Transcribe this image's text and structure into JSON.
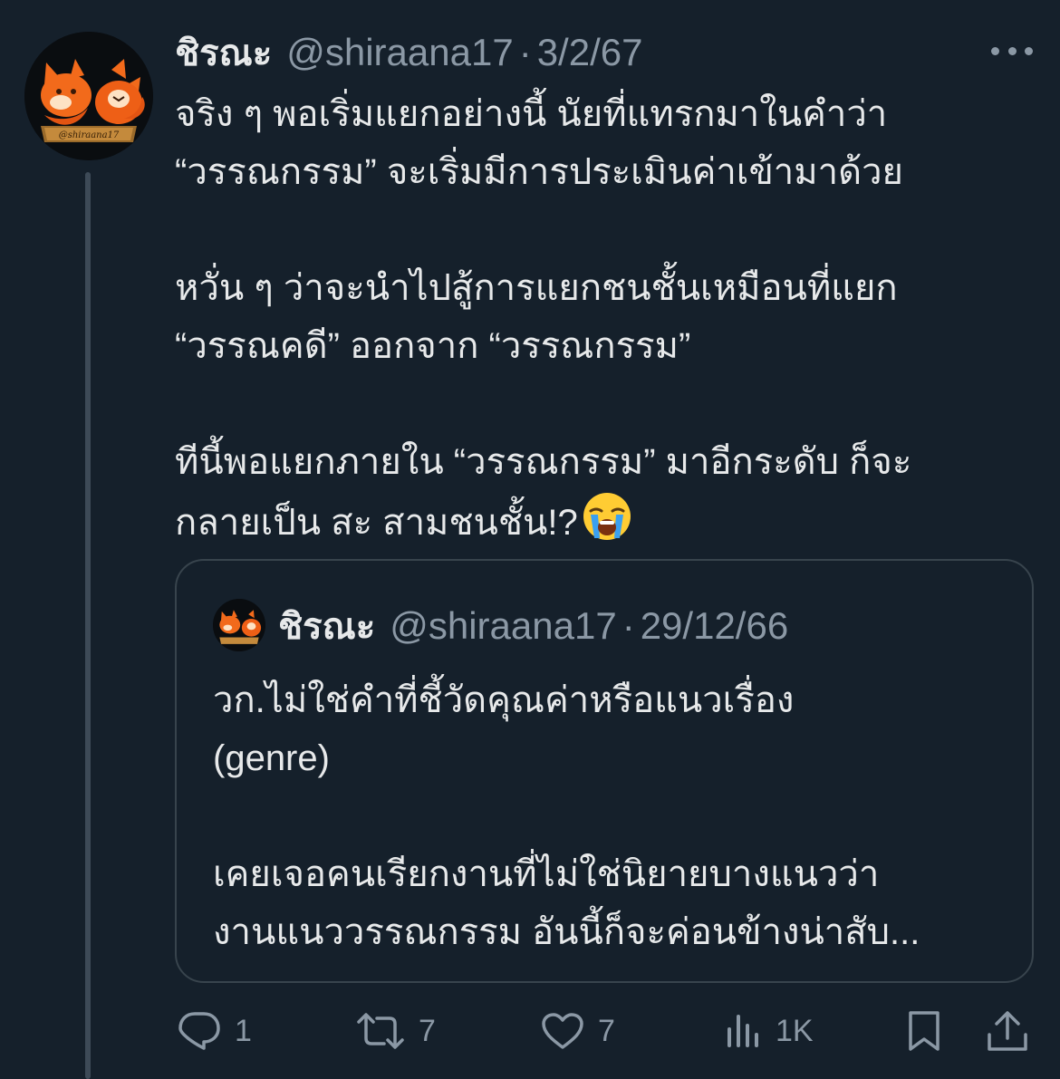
{
  "tweet": {
    "author_name": "ชิรณะ",
    "handle": "@shiraana17",
    "separator": "·",
    "date": "3/2/67",
    "paragraphs": [
      "จริง ๆ พอเริ่มแยกอย่างนี้ นัยที่แทรกมาในคำว่า\n“วรรณกรรม” จะเริ่มมีการประเมินค่าเข้ามาด้วย",
      "หวั่น ๆ ว่าจะนำไปสู้การแยกชนชั้นเหมือนที่แยก\n“วรรณคดี” ออกจาก “วรรณกรรม”",
      "ทีนี้พอแยกภายใน “วรรณกรรม” มาอีกระดับ ก็จะ\nกลายเป็น สะ สามชนชั้น!?"
    ],
    "emoji_name": "loudly-crying-face-emoji",
    "avatar_banner_text": "@shiraana17"
  },
  "quoted": {
    "author_name": "ชิรณะ",
    "handle": "@shiraana17",
    "separator": "·",
    "date": "29/12/66",
    "paragraphs": [
      "วก.ไม่ใช่คำที่ชี้วัดคุณค่าหรือแนวเรื่อง\n(genre)",
      "เคยเจอคนเรียกงานที่ไม่ใช่นิยายบางแนวว่า\nงานแนววรรณกรรม อันนี้ก็จะค่อนข้างน่าสับ..."
    ]
  },
  "actions": {
    "reply_count": "1",
    "retweet_count": "7",
    "like_count": "7",
    "views_count": "1K",
    "icons": [
      "reply-icon",
      "retweet-icon",
      "like-icon",
      "views-icon",
      "bookmark-icon",
      "share-icon"
    ]
  },
  "colors": {
    "background": "#15202b",
    "text_primary": "#e7e9ea",
    "text_secondary": "#8b98a5",
    "border": "#38444d",
    "avatar_orange": "#f26a1b"
  }
}
